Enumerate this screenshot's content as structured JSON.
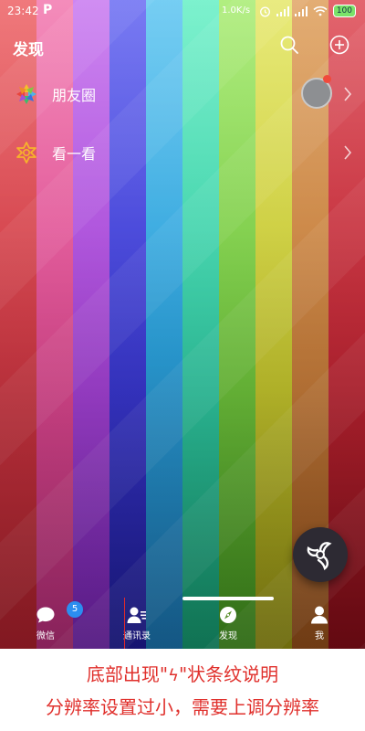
{
  "status_bar": {
    "time": "23:42",
    "app_mark": "P",
    "net_speed": "1.0K/s",
    "battery": "100",
    "icons": [
      "alarm-icon",
      "signal-icon",
      "signal-icon",
      "wifi-icon",
      "battery-icon"
    ]
  },
  "header": {
    "title": "发现",
    "search_icon": "search-icon",
    "add_icon": "plus-circle-icon"
  },
  "menu": [
    {
      "label": "朋友圈",
      "icon": "moments-icon",
      "has_avatar": true,
      "has_red_dot": true
    },
    {
      "label": "看一看",
      "icon": "top-stories-icon",
      "has_avatar": false,
      "has_red_dot": false
    }
  ],
  "tabbar": {
    "tabs": [
      {
        "label": "微信",
        "icon": "chat-icon"
      },
      {
        "label": "通讯录",
        "icon": "contacts-icon"
      },
      {
        "label": "发现",
        "icon": "compass-icon"
      },
      {
        "label": "我",
        "icon": "person-icon"
      }
    ],
    "badge_count": "5"
  },
  "annotation": {
    "line1_pre": "底部出现\"",
    "line1_post": "\"状条纹说明",
    "line2": "分辨率设置过小，需要上调分辨率"
  },
  "colors": {
    "stripes": [
      "#d8424f",
      "#e0558f",
      "#b44fd0",
      "#3a3ad0",
      "#2a9fd8",
      "#28c7a3",
      "#6fc23e",
      "#b9bf2d",
      "#c47a3a",
      "#b2212c"
    ],
    "accent_red": "#e0302c",
    "badge_blue": "#2b8ef0"
  }
}
